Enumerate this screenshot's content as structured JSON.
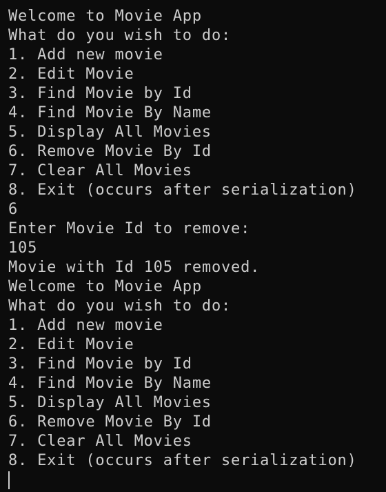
{
  "colors": {
    "background": "#0c0c0c",
    "foreground": "#cccccc"
  },
  "lines": [
    "Welcome to Movie App",
    "What do you wish to do:",
    "1. Add new movie",
    "2. Edit Movie",
    "3. Find Movie by Id",
    "4. Find Movie By Name",
    "5. Display All Movies",
    "6. Remove Movie By Id",
    "7. Clear All Movies",
    "8. Exit (occurs after serialization)",
    "6",
    "Enter Movie Id to remove:",
    "105",
    "Movie with Id 105 removed.",
    "Welcome to Movie App",
    "What do you wish to do:",
    "1. Add new movie",
    "2. Edit Movie",
    "3. Find Movie by Id",
    "4. Find Movie By Name",
    "5. Display All Movies",
    "6. Remove Movie By Id",
    "7. Clear All Movies",
    "8. Exit (occurs after serialization)"
  ]
}
